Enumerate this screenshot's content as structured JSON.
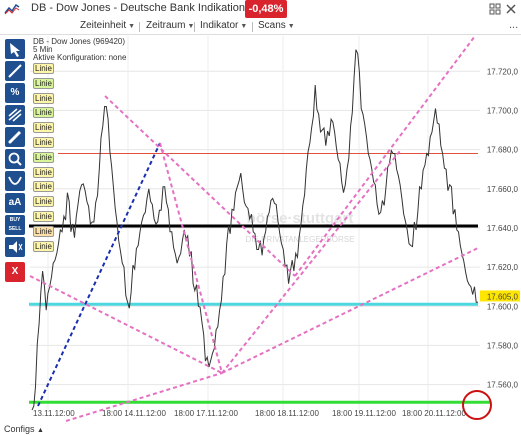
{
  "window": {
    "title": "DB - Dow Jones - Deutsche Bank Indikation",
    "change_badge": "-0,48%",
    "accent_red": "#d9232d",
    "icons": [
      "chart-logo-icon",
      "grid-icon",
      "close-icon"
    ]
  },
  "menu": [
    {
      "label": "Zeiteinheit"
    },
    {
      "label": "Zeitraum"
    },
    {
      "label": "Indikator"
    },
    {
      "label": "Scans"
    }
  ],
  "menu_more": "...",
  "toolbar": {
    "tools": [
      {
        "name": "cursor-tool",
        "icon": "cursor-icon"
      },
      {
        "name": "line-tool",
        "icon": "line-icon"
      },
      {
        "name": "percent-tool",
        "icon": "percent-icon",
        "label": "%"
      },
      {
        "name": "fibonacci-tool",
        "icon": "lines-icon"
      },
      {
        "name": "pen-tool",
        "icon": "pen-icon"
      },
      {
        "name": "zoom-tool",
        "icon": "zoom-icon"
      },
      {
        "name": "arc-tool",
        "icon": "arc-icon"
      },
      {
        "name": "text-tool",
        "icon": "text-icon",
        "label": "aA"
      },
      {
        "name": "buy-sell-tool",
        "icon": "buy-sell-icon",
        "label": "BUY SELL"
      },
      {
        "name": "sound-tool",
        "icon": "speaker-icon"
      },
      {
        "name": "delete-tool",
        "icon": "delete-icon",
        "label": "X"
      }
    ],
    "line_labels": [
      "Linie",
      "Linie",
      "Linie",
      "Linie",
      "Linie",
      "Linie",
      "Linie",
      "Linie",
      "Linie",
      "Linie",
      "Linie",
      "Linie",
      "Linie"
    ]
  },
  "chart_info": {
    "name": "DB - Dow Jones (969420)",
    "interval": "5 Min",
    "config": "Aktive Konfiguration: none"
  },
  "watermark": {
    "line1": "DIE PRIVATANLEGERBÖRSE"
  },
  "chart_data": {
    "type": "line",
    "title": "DB - Dow Jones (969420)",
    "yticks": [
      "17.720,0",
      "17.700,0",
      "17.680,0",
      "17.660,0",
      "17.640,0",
      "17.620,0",
      "17.600,0",
      "17.580,0",
      "17.560,0"
    ],
    "ytick_values": [
      17720,
      17700,
      17680,
      17660,
      17640,
      17620,
      17600,
      17580,
      17560
    ],
    "ylim": [
      17546,
      17738
    ],
    "xticks": [
      "13.11.12:00",
      "18:00 14.11.12:00",
      "18:00 17.11.12:00",
      "18:00 18.11.12:00",
      "18:00 19.11.12:00",
      "18:00 20.11.12:00"
    ],
    "last_price": "17.605,0",
    "series": [
      {
        "values": [
          17550,
          17560,
          17590,
          17615,
          17600,
          17610,
          17620,
          17630,
          17640,
          17645,
          17655,
          17640,
          17635,
          17650,
          17665,
          17660,
          17650,
          17640,
          17655,
          17670,
          17690,
          17705,
          17680,
          17660,
          17640,
          17630,
          17620,
          17600,
          17610,
          17620,
          17630,
          17640,
          17650,
          17660,
          17650,
          17645,
          17650,
          17660,
          17650,
          17640,
          17630,
          17620,
          17630,
          17640,
          17635,
          17625,
          17610,
          17600,
          17590,
          17575,
          17570,
          17575,
          17585,
          17600,
          17615,
          17630,
          17640,
          17650,
          17660,
          17665,
          17655,
          17650,
          17645,
          17640,
          17630,
          17625,
          17635,
          17650,
          17655,
          17650,
          17640,
          17630,
          17620,
          17615,
          17620,
          17625,
          17640,
          17660,
          17680,
          17690,
          17710,
          17700,
          17690,
          17680,
          17690,
          17695,
          17680,
          17670,
          17660,
          17670,
          17690,
          17720,
          17730,
          17700,
          17690,
          17680,
          17670,
          17660,
          17650,
          17655,
          17660,
          17670,
          17680,
          17670,
          17660,
          17650,
          17640,
          17630,
          17640,
          17650,
          17660,
          17670,
          17680,
          17690,
          17700,
          17690,
          17680,
          17670,
          17660,
          17650,
          17640,
          17630,
          17620,
          17615,
          17610,
          17608,
          17605
        ]
      }
    ],
    "lines": [
      {
        "name": "black-horizontal",
        "color": "#000000",
        "y": 17641
      },
      {
        "name": "red-horizontal",
        "color": "#e0503c",
        "y": 17678
      },
      {
        "name": "cyan-horizontal",
        "color": "#4dd8e0",
        "y": 17601
      },
      {
        "name": "green-horizontal",
        "color": "#33dd33",
        "y": 17551
      }
    ],
    "grid": true
  }
}
